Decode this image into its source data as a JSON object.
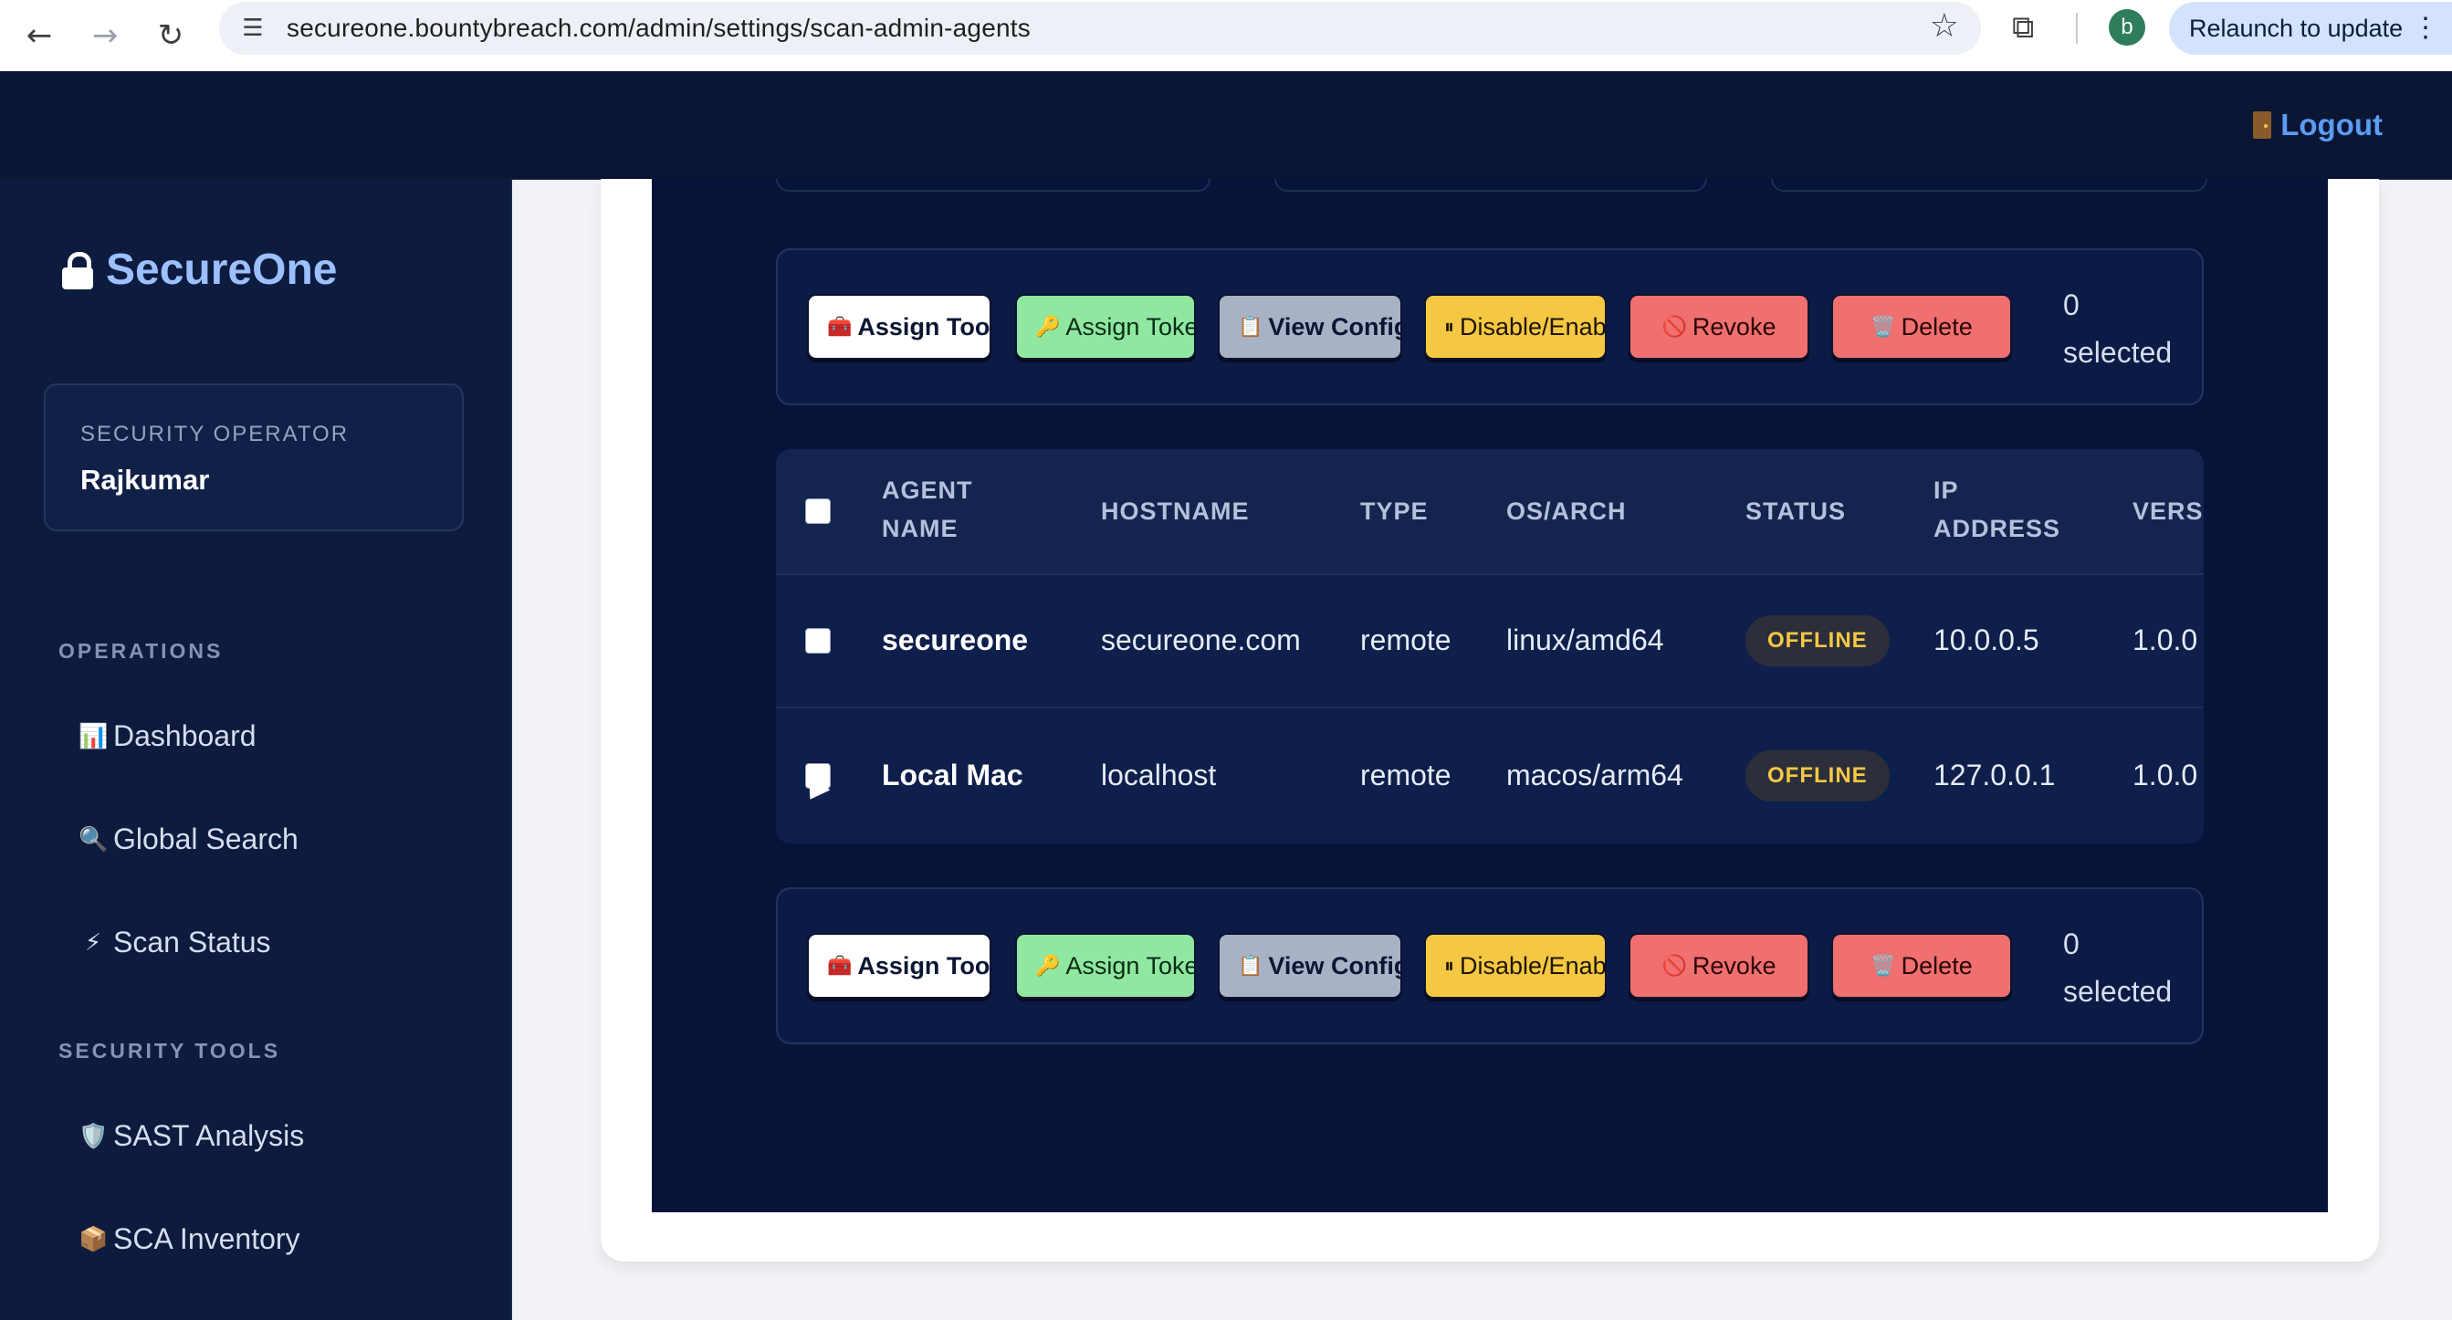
{
  "browser": {
    "url": "secureone.bountybreach.com/admin/settings/scan-admin-agents",
    "profile_initial": "b",
    "relaunch_label": "Relaunch to update",
    "icons": {
      "back": "back-arrow-icon",
      "forward": "forward-arrow-icon",
      "reload": "reload-icon",
      "site_info": "tune-icon",
      "bookmark": "star-icon",
      "lens": "screen-search-icon",
      "menu": "vertical-dots-icon"
    }
  },
  "header": {
    "logout_label": "Logout"
  },
  "sidebar": {
    "brand": "SecureOne",
    "user": {
      "role": "SECURITY OPERATOR",
      "name": "Rajkumar"
    },
    "sections": [
      {
        "label": "OPERATIONS",
        "items": [
          {
            "icon": "📊",
            "label": "Dashboard"
          },
          {
            "icon": "🔍",
            "label": "Global Search"
          },
          {
            "icon": "⚡",
            "label": "Scan Status"
          }
        ]
      },
      {
        "label": "SECURITY TOOLS",
        "items": [
          {
            "icon": "🛡️",
            "label": "SAST Analysis"
          },
          {
            "icon": "📦",
            "label": "SCA Inventory"
          }
        ]
      }
    ]
  },
  "actions": {
    "assign_tools": "Assign Tools",
    "assign_token": "Assign Token",
    "view_config": "View Config",
    "disable_enable": "Disable/Enable",
    "revoke": "Revoke",
    "delete": "Delete",
    "selected_count": "0",
    "selected_label": "selected",
    "icons": {
      "assign_tools": "🧰",
      "assign_token": "🔑",
      "view_config": "📋",
      "disable_enable": "⏸",
      "revoke": "🚫",
      "delete": "🗑️"
    }
  },
  "table": {
    "columns": [
      "AGENT NAME",
      "HOSTNAME",
      "TYPE",
      "OS/ARCH",
      "STATUS",
      "IP ADDRESS",
      "VERSION"
    ],
    "rows": [
      {
        "agent": "secureone",
        "hostname": "secureone.com",
        "type": "remote",
        "os": "linux/amd64",
        "status": "OFFLINE",
        "ip": "10.0.0.5",
        "version": "1.0.0"
      },
      {
        "agent": "Local Mac",
        "hostname": "localhost",
        "type": "remote",
        "os": "macos/arm64",
        "status": "OFFLINE",
        "ip": "127.0.0.1",
        "version": "1.0.0"
      }
    ]
  },
  "colors": {
    "app_bg": "#0a1633",
    "sidebar_bg": "#0d1b3e",
    "brand": "#9cc0ff",
    "logout": "#5b9cf5",
    "status_offline": "#f5c843"
  }
}
